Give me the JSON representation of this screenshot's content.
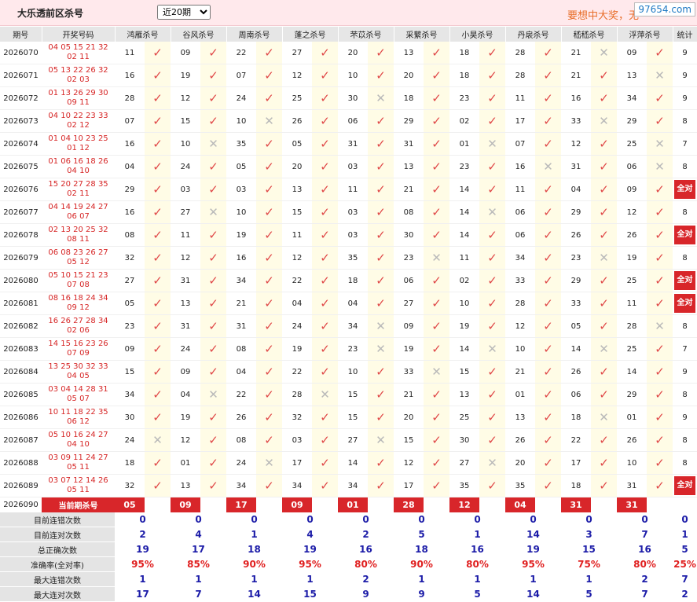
{
  "header": {
    "title": "大乐透前区杀号",
    "period_select": "近20期",
    "slogan": "要想中大奖，无",
    "watermark": "97654.com"
  },
  "columns": [
    "期号",
    "开奖号码",
    "鸿雁杀号",
    "谷风杀号",
    "周南杀号",
    "蓬之杀号",
    "芣苡杀号",
    "采蘩杀号",
    "小昊杀号",
    "丹扆杀号",
    "嵇嵇杀号",
    "浮萍杀号",
    "统计"
  ],
  "rows": [
    {
      "period": "2026070",
      "award": [
        "04 05 15 21 32",
        "02 11"
      ],
      "kills": [
        "11",
        "09",
        "22",
        "27",
        "20",
        "13",
        "18",
        "28",
        "21",
        "09"
      ],
      "marks": [
        1,
        1,
        1,
        1,
        1,
        1,
        1,
        1,
        0,
        1
      ],
      "stat": "9"
    },
    {
      "period": "2026071",
      "award": [
        "05 13 22 26 32",
        "02 03"
      ],
      "kills": [
        "16",
        "19",
        "07",
        "12",
        "10",
        "20",
        "18",
        "28",
        "21",
        "13"
      ],
      "marks": [
        1,
        1,
        1,
        1,
        1,
        1,
        1,
        1,
        1,
        0
      ],
      "stat": "9"
    },
    {
      "period": "2026072",
      "award": [
        "01 13 26 29 30",
        "09 11"
      ],
      "kills": [
        "28",
        "12",
        "24",
        "25",
        "30",
        "18",
        "23",
        "11",
        "16",
        "34"
      ],
      "marks": [
        1,
        1,
        1,
        1,
        0,
        1,
        1,
        1,
        1,
        1
      ],
      "stat": "9"
    },
    {
      "period": "2026073",
      "award": [
        "04 10 22 23 33",
        "02 12"
      ],
      "kills": [
        "07",
        "15",
        "10",
        "26",
        "06",
        "29",
        "02",
        "17",
        "33",
        "29"
      ],
      "marks": [
        1,
        1,
        0,
        1,
        1,
        1,
        1,
        1,
        0,
        1
      ],
      "stat": "8"
    },
    {
      "period": "2026074",
      "award": [
        "01 04 10 23 25",
        "01 12"
      ],
      "kills": [
        "16",
        "10",
        "35",
        "05",
        "31",
        "31",
        "01",
        "07",
        "12",
        "25"
      ],
      "marks": [
        1,
        0,
        1,
        1,
        1,
        1,
        0,
        1,
        1,
        0
      ],
      "stat": "7"
    },
    {
      "period": "2026075",
      "award": [
        "01 06 16 18 26",
        "04 10"
      ],
      "kills": [
        "04",
        "24",
        "05",
        "20",
        "03",
        "13",
        "23",
        "16",
        "31",
        "06"
      ],
      "marks": [
        1,
        1,
        1,
        1,
        1,
        1,
        1,
        0,
        1,
        0
      ],
      "stat": "8"
    },
    {
      "period": "2026076",
      "award": [
        "15 20 27 28 35",
        "02 11"
      ],
      "kills": [
        "29",
        "03",
        "03",
        "13",
        "11",
        "21",
        "14",
        "11",
        "04",
        "09"
      ],
      "marks": [
        1,
        1,
        1,
        1,
        1,
        1,
        1,
        1,
        1,
        1
      ],
      "stat": "全对"
    },
    {
      "period": "2026077",
      "award": [
        "04 14 19 24 27",
        "06 07"
      ],
      "kills": [
        "16",
        "27",
        "10",
        "15",
        "03",
        "08",
        "14",
        "06",
        "29",
        "12"
      ],
      "marks": [
        1,
        0,
        1,
        1,
        1,
        1,
        0,
        1,
        1,
        1
      ],
      "stat": "8"
    },
    {
      "period": "2026078",
      "award": [
        "02 13 20 25 32",
        "08 11"
      ],
      "kills": [
        "08",
        "11",
        "19",
        "11",
        "03",
        "30",
        "14",
        "06",
        "26",
        "26"
      ],
      "marks": [
        1,
        1,
        1,
        1,
        1,
        1,
        1,
        1,
        1,
        1
      ],
      "stat": "全对"
    },
    {
      "period": "2026079",
      "award": [
        "06 08 23 26 27",
        "05 12"
      ],
      "kills": [
        "32",
        "12",
        "16",
        "12",
        "35",
        "23",
        "11",
        "34",
        "23",
        "19"
      ],
      "marks": [
        1,
        1,
        1,
        1,
        1,
        0,
        1,
        1,
        0,
        1
      ],
      "stat": "8"
    },
    {
      "period": "2026080",
      "award": [
        "05 10 15 21 23",
        "07 08"
      ],
      "kills": [
        "27",
        "31",
        "34",
        "22",
        "18",
        "06",
        "02",
        "33",
        "29",
        "25"
      ],
      "marks": [
        1,
        1,
        1,
        1,
        1,
        1,
        1,
        1,
        1,
        1
      ],
      "stat": "全对"
    },
    {
      "period": "2026081",
      "award": [
        "08 16 18 24 34",
        "09 12"
      ],
      "kills": [
        "05",
        "13",
        "21",
        "04",
        "04",
        "27",
        "10",
        "28",
        "33",
        "11"
      ],
      "marks": [
        1,
        1,
        1,
        1,
        1,
        1,
        1,
        1,
        1,
        1
      ],
      "stat": "全对"
    },
    {
      "period": "2026082",
      "award": [
        "16 26 27 28 34",
        "02 06"
      ],
      "kills": [
        "23",
        "31",
        "31",
        "24",
        "34",
        "09",
        "19",
        "12",
        "05",
        "28"
      ],
      "marks": [
        1,
        1,
        1,
        1,
        0,
        1,
        1,
        1,
        1,
        0
      ],
      "stat": "8"
    },
    {
      "period": "2026083",
      "award": [
        "14 15 16 23 26",
        "07 09"
      ],
      "kills": [
        "09",
        "24",
        "08",
        "19",
        "23",
        "19",
        "14",
        "10",
        "14",
        "25"
      ],
      "marks": [
        1,
        1,
        1,
        1,
        0,
        1,
        0,
        1,
        0,
        1
      ],
      "stat": "7"
    },
    {
      "period": "2026084",
      "award": [
        "13 25 30 32 33",
        "04 05"
      ],
      "kills": [
        "15",
        "09",
        "04",
        "22",
        "10",
        "33",
        "15",
        "21",
        "26",
        "14"
      ],
      "marks": [
        1,
        1,
        1,
        1,
        1,
        0,
        1,
        1,
        1,
        1
      ],
      "stat": "9"
    },
    {
      "period": "2026085",
      "award": [
        "03 04 14 28 31",
        "05 07"
      ],
      "kills": [
        "34",
        "04",
        "22",
        "28",
        "15",
        "21",
        "13",
        "01",
        "06",
        "29"
      ],
      "marks": [
        1,
        0,
        1,
        0,
        1,
        1,
        1,
        1,
        1,
        1
      ],
      "stat": "8"
    },
    {
      "period": "2026086",
      "award": [
        "10 11 18 22 35",
        "06 12"
      ],
      "kills": [
        "30",
        "19",
        "26",
        "32",
        "15",
        "20",
        "25",
        "13",
        "18",
        "01"
      ],
      "marks": [
        1,
        1,
        1,
        1,
        1,
        1,
        1,
        1,
        0,
        1
      ],
      "stat": "9"
    },
    {
      "period": "2026087",
      "award": [
        "05 10 16 24 27",
        "04 10"
      ],
      "kills": [
        "24",
        "12",
        "08",
        "03",
        "27",
        "15",
        "30",
        "26",
        "22",
        "26"
      ],
      "marks": [
        0,
        1,
        1,
        1,
        0,
        1,
        1,
        1,
        1,
        1
      ],
      "stat": "8"
    },
    {
      "period": "2026088",
      "award": [
        "03 09 11 24 27",
        "05 11"
      ],
      "kills": [
        "18",
        "01",
        "24",
        "17",
        "14",
        "12",
        "27",
        "20",
        "17",
        "10"
      ],
      "marks": [
        1,
        1,
        0,
        1,
        1,
        1,
        0,
        1,
        1,
        1
      ],
      "stat": "8"
    },
    {
      "period": "2026089",
      "award": [
        "03 07 12 14 26",
        "05 11"
      ],
      "kills": [
        "32",
        "13",
        "34",
        "34",
        "34",
        "17",
        "35",
        "35",
        "18",
        "31"
      ],
      "marks": [
        1,
        1,
        1,
        1,
        1,
        1,
        1,
        1,
        1,
        1
      ],
      "stat": "全对"
    }
  ],
  "current": {
    "period": "2026090",
    "label": "当前期杀号",
    "kills": [
      "05",
      "09",
      "17",
      "09",
      "01",
      "28",
      "12",
      "04",
      "31",
      "31"
    ]
  },
  "stats": [
    {
      "label": "目前连错次数",
      "values": [
        "0",
        "0",
        "0",
        "0",
        "0",
        "0",
        "0",
        "0",
        "0",
        "0",
        "0"
      ]
    },
    {
      "label": "目前连对次数",
      "values": [
        "2",
        "4",
        "1",
        "4",
        "2",
        "5",
        "1",
        "14",
        "3",
        "7",
        "1"
      ]
    },
    {
      "label": "总正确次数",
      "values": [
        "19",
        "17",
        "18",
        "19",
        "16",
        "18",
        "16",
        "19",
        "15",
        "16",
        "5"
      ]
    },
    {
      "label": "准确率(全对率)",
      "values": [
        "95%",
        "85%",
        "90%",
        "95%",
        "80%",
        "90%",
        "80%",
        "95%",
        "75%",
        "80%",
        "25%"
      ]
    },
    {
      "label": "最大连错次数",
      "values": [
        "1",
        "1",
        "1",
        "1",
        "2",
        "1",
        "1",
        "1",
        "1",
        "2",
        "7"
      ]
    },
    {
      "label": "最大连对次数",
      "values": [
        "17",
        "7",
        "14",
        "15",
        "9",
        "9",
        "5",
        "14",
        "5",
        "7",
        "2"
      ]
    }
  ],
  "glyphs": {
    "ok": "✓",
    "bad": "✕"
  },
  "colors": {
    "accent": "#d8262a",
    "ok_mark": "#e04848",
    "bad_mark": "#b9b9b9",
    "stat_blue": "#1c1ca8",
    "header_bg": "#ffe9ec"
  }
}
